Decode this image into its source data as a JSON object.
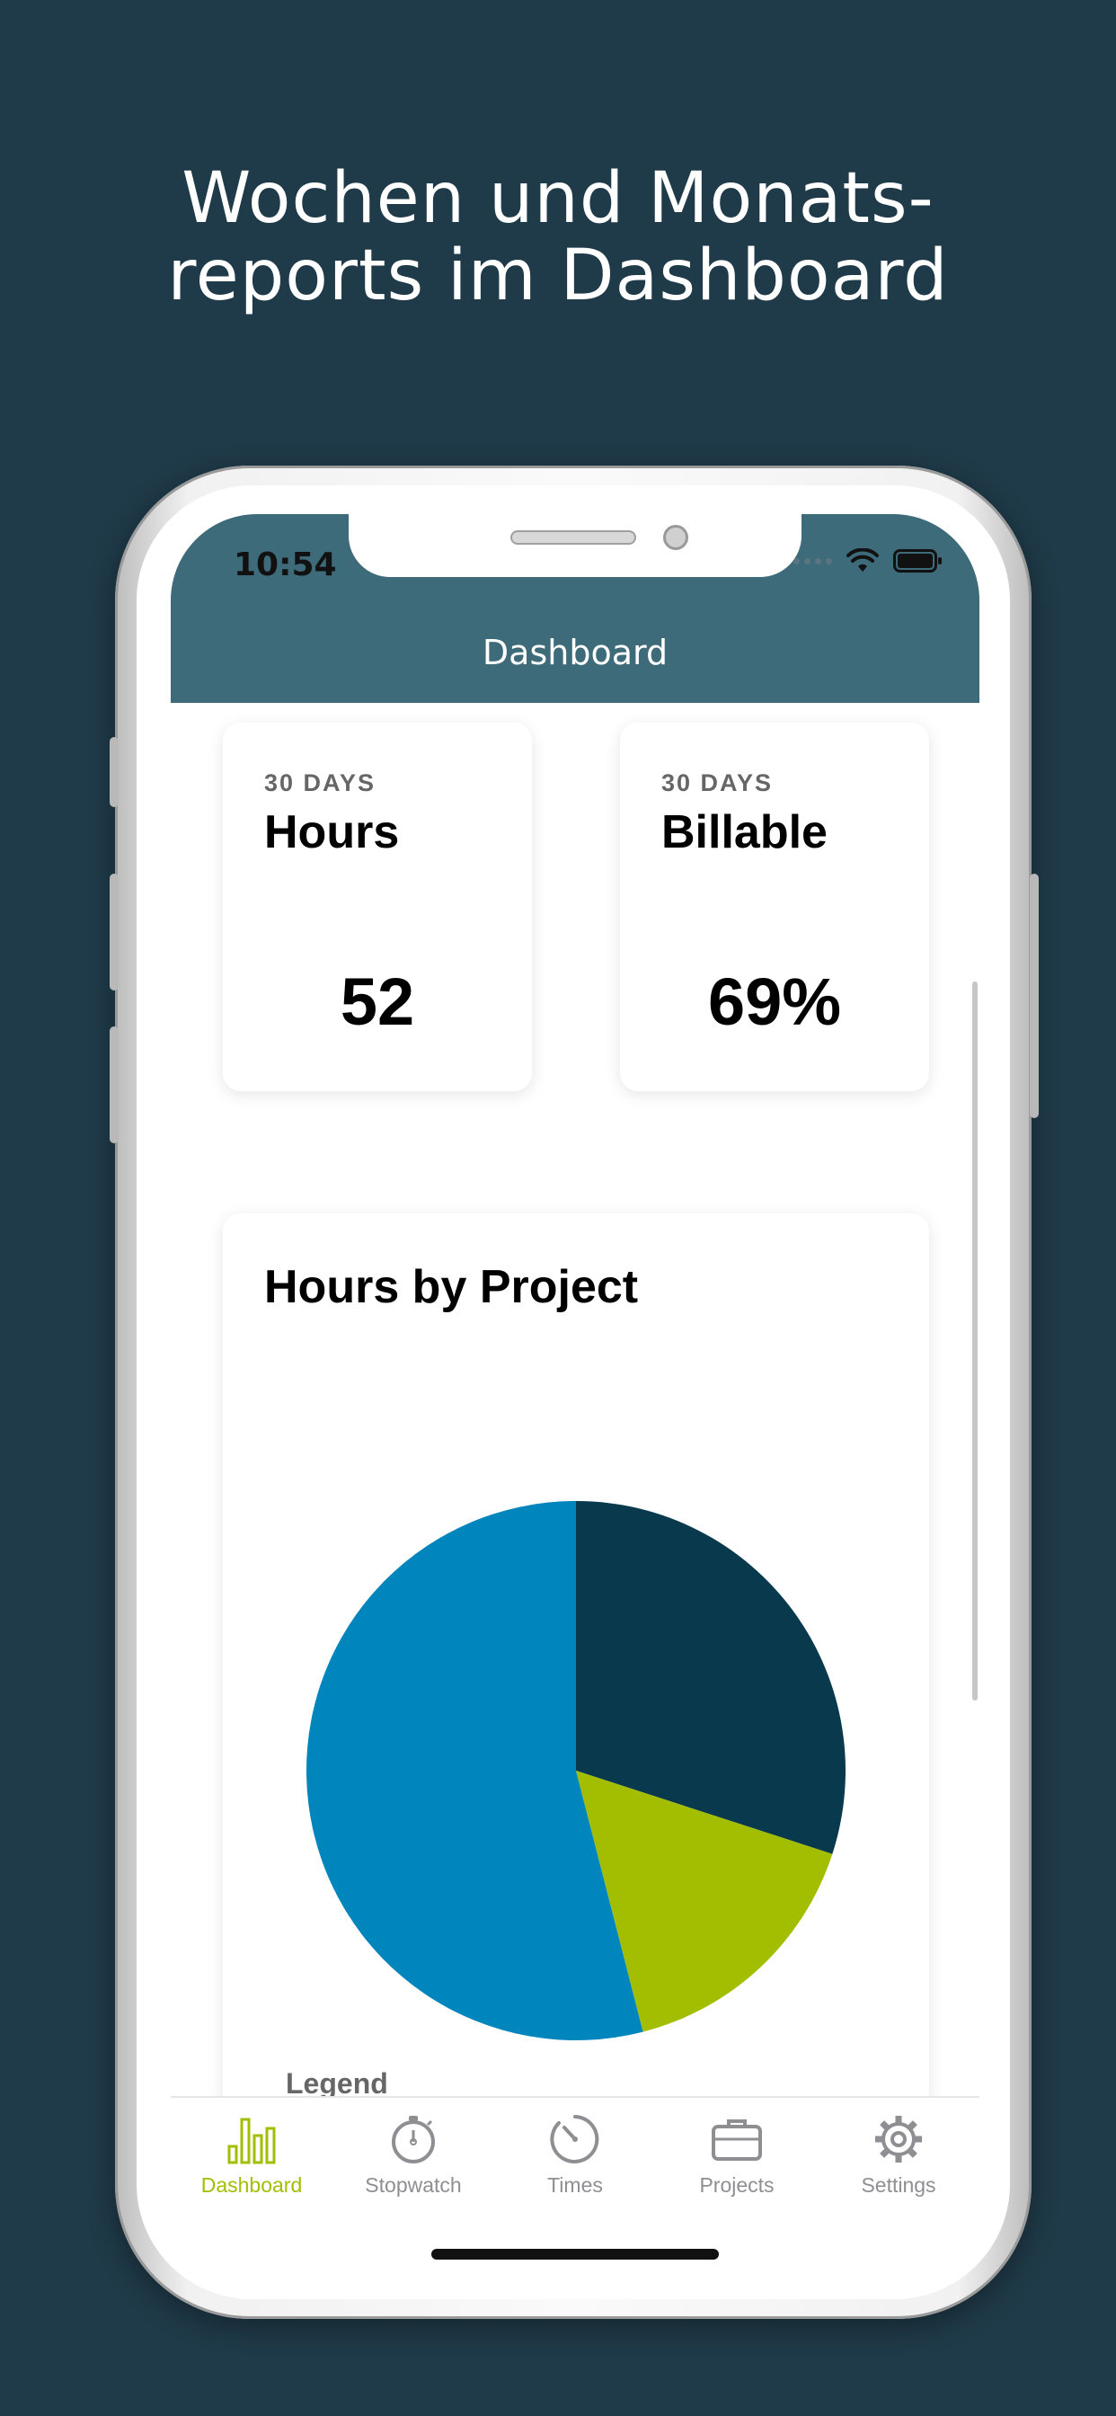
{
  "promo": {
    "headline_line1": "Wochen und Monats-",
    "headline_line2": "reports im Dashboard"
  },
  "status_bar": {
    "time": "10:54",
    "wifi_icon": "wifi-icon",
    "battery_icon": "battery-icon"
  },
  "nav": {
    "title": "Dashboard"
  },
  "cards": [
    {
      "kicker": "30 DAYS",
      "title": "Hours",
      "value": "52"
    },
    {
      "kicker": "30 DAYS",
      "title": "Billable",
      "value": "69%"
    }
  ],
  "chart_panel": {
    "title": "Hours by Project",
    "legend_label": "Legend"
  },
  "chart_data": {
    "type": "pie",
    "slices": [
      {
        "share": 0.3,
        "color": "#08394d"
      },
      {
        "share": 0.16,
        "color": "#a3be00"
      },
      {
        "share": 0.54,
        "color": "#0085bd"
      }
    ]
  },
  "tabbar": {
    "active": "Dashboard",
    "active_color": "#a3be00",
    "inactive_color": "#8e8e93",
    "items": [
      {
        "label": "Dashboard",
        "icon": "bar-chart-icon"
      },
      {
        "label": "Stopwatch",
        "icon": "stopwatch-icon"
      },
      {
        "label": "Times",
        "icon": "clock-dial-icon"
      },
      {
        "label": "Projects",
        "icon": "briefcase-icon"
      },
      {
        "label": "Settings",
        "icon": "gear-icon"
      }
    ]
  }
}
